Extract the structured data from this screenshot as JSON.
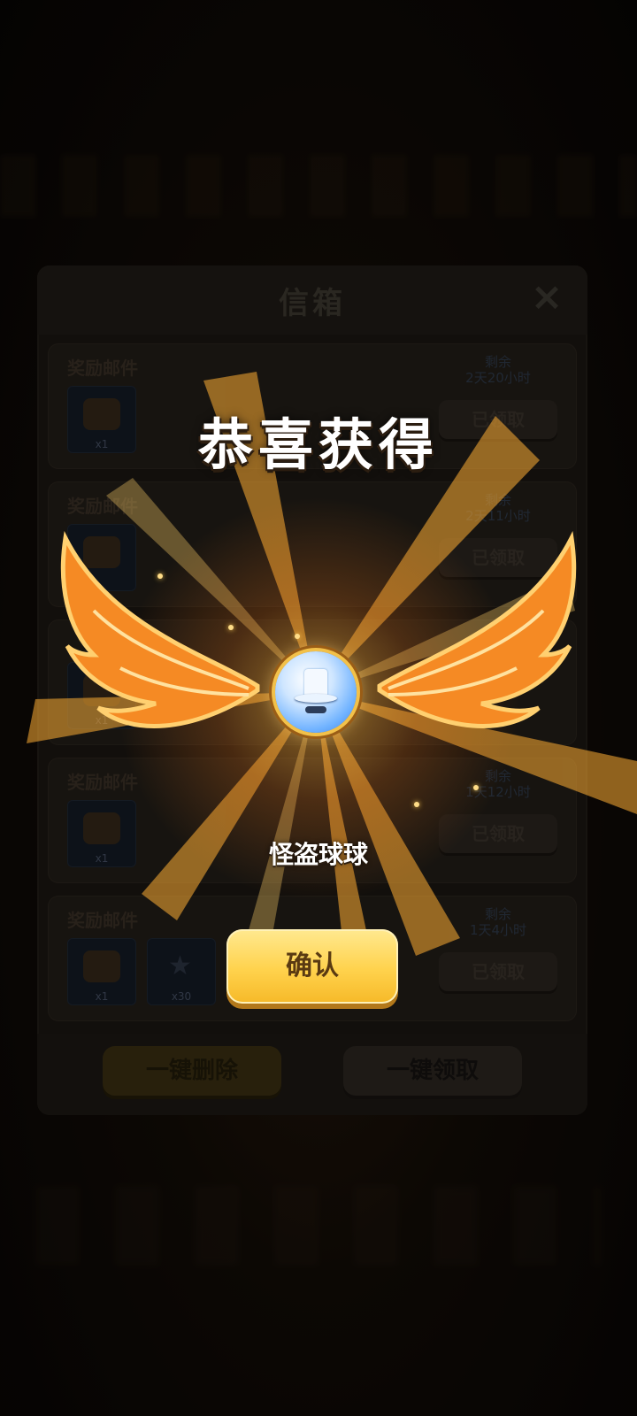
{
  "mailbox": {
    "title": "信箱",
    "close_icon": "×",
    "items": [
      {
        "title": "奖励邮件",
        "remain_label": "剩余",
        "remain_time": "2天20小时",
        "status": "已领取",
        "rewards": [
          {
            "type": "chest",
            "qty": "x1"
          }
        ]
      },
      {
        "title": "奖励邮件",
        "remain_label": "剩余",
        "remain_time": "2天11小时",
        "status": "已领取",
        "rewards": [
          {
            "type": "chest",
            "qty": ""
          }
        ]
      },
      {
        "title": "",
        "remain_label": "",
        "remain_time": "",
        "status": "",
        "rewards": [
          {
            "type": "chest",
            "qty": "x1"
          }
        ]
      },
      {
        "title": "奖励邮件",
        "remain_label": "剩余",
        "remain_time": "1天12小时",
        "status": "已领取",
        "rewards": [
          {
            "type": "chest",
            "qty": "x1"
          }
        ]
      },
      {
        "title": "奖励邮件",
        "remain_label": "剩余",
        "remain_time": "1天4小时",
        "status": "已领取",
        "rewards": [
          {
            "type": "chest",
            "qty": "x1"
          },
          {
            "type": "star",
            "qty": "x30"
          }
        ]
      }
    ],
    "delete_all_label": "一键删除",
    "claim_all_label": "一键领取"
  },
  "reward_popup": {
    "title": "恭喜获得",
    "item_name": "怪盗球球",
    "item_icon": "phantom-thief-ball-icon",
    "confirm_label": "确认"
  },
  "colors": {
    "accent_gold": "#ffd24c",
    "ray_orange": "#ffb43c"
  }
}
